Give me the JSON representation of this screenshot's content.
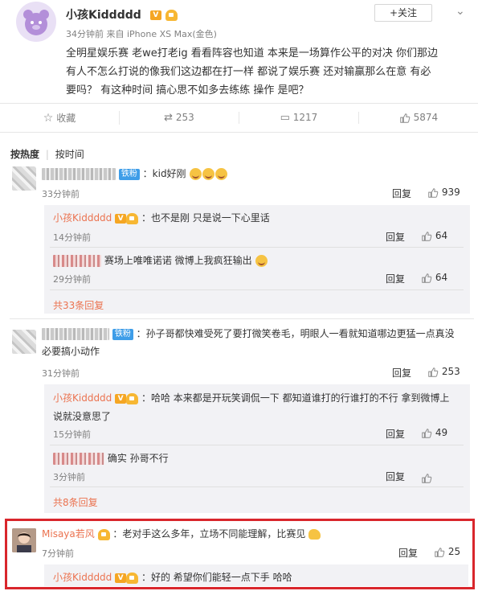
{
  "post": {
    "author": "小孩Kiddddd",
    "time": "34分钟前",
    "source": "来自 iPhone XS Max(金色)",
    "follow_label": "+关注",
    "content_lines": [
      "全明星娱乐赛 老we打老ig 看看阵容也知道 本来是一场算作公平的对决  你们那边",
      "有人不怎么打说的像我们这边都在打一样  都说了娱乐赛 还对输赢那么在意 有必",
      "要吗？  有这种时间 搞心思不如多去练练 操作 是吧？"
    ]
  },
  "actions": {
    "favorite": "收藏",
    "repost": "253",
    "comment": "1217",
    "like": "5874"
  },
  "sort": {
    "hot": "按热度",
    "time": "按时间"
  },
  "reply_label": "回复",
  "comments": [
    {
      "text": "：kid好刚",
      "fan_badge": "铁粉",
      "time": "33分钟前",
      "likes": "939",
      "replies": [
        {
          "author": "小孩Kiddddd",
          "text": "：也不是刚 只是说一下心里话",
          "time": "14分钟前",
          "likes": "64"
        },
        {
          "text": "赛场上唯唯诺诺 微博上我疯狂输出",
          "time": "29分钟前",
          "likes": "64"
        }
      ],
      "more": "共33条回复"
    },
    {
      "text_lines": [
        "：孙子哥都快难受死了要打微笑卷毛，明眼人一看就知道哪边更猛一点真没",
        "必要搞小动作"
      ],
      "fan_badge": "铁粉",
      "time": "31分钟前",
      "likes": "253",
      "replies": [
        {
          "author": "小孩Kiddddd",
          "text_lines": [
            "：哈哈  本来都是开玩笑调侃一下 都知道谁打的行谁打的不行 拿到微博上",
            "说就没意思了"
          ],
          "time": "15分钟前",
          "likes": "49"
        },
        {
          "text": "确实  孙哥不行",
          "time": "3分钟前",
          "likes": ""
        }
      ],
      "more": "共8条回复"
    },
    {
      "author": "Misaya若风",
      "text": "：老对手这么多年，立场不同能理解，比赛见",
      "time": "7分钟前",
      "likes": "25",
      "replies": [
        {
          "author": "小孩Kiddddd",
          "text": "：好的 希望你们能轻一点下手 哈哈"
        }
      ]
    }
  ],
  "colors": {
    "highlight": "#d9262c",
    "link": "#eb7350",
    "badge": "#3e9de8"
  }
}
